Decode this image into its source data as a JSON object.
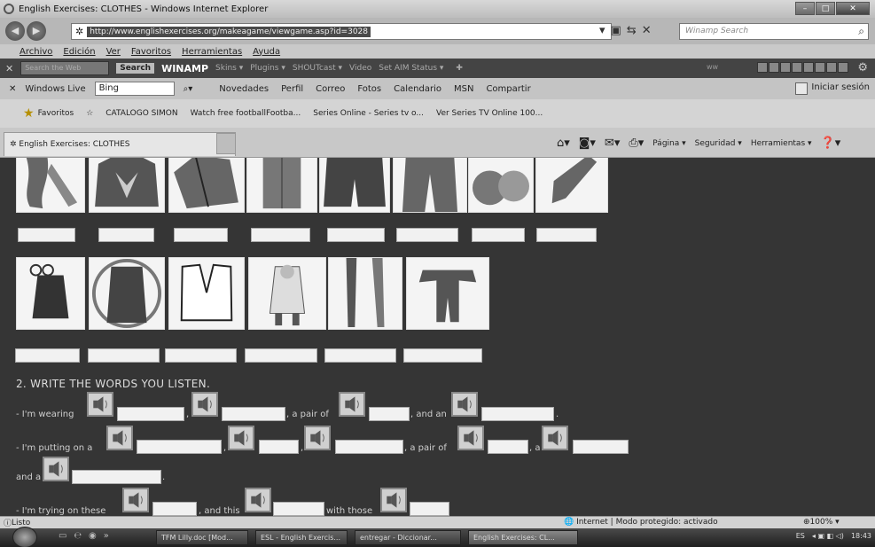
{
  "window": {
    "title": "English Exercises: CLOTHES - Windows Internet Explorer"
  },
  "address": {
    "url": "http://www.englishexercises.org/makeagame/viewgame.asp?id=3028",
    "search_placeholder": "Winamp Search"
  },
  "menu": [
    "Archivo",
    "Edición",
    "Ver",
    "Favoritos",
    "Herramientas",
    "Ayuda"
  ],
  "winamp_bar": {
    "search_placeholder": "Search the Web",
    "search_button": "Search",
    "brand": "WINAMP",
    "items": [
      "Skins ▾",
      "Plugins ▾",
      "SHOUTcast ▾",
      "Video",
      "Set AIM Status ▾"
    ],
    "ww": "ww"
  },
  "live_bar": {
    "label": "Windows Live",
    "search_value": "Bing",
    "links": [
      "Novedades",
      "Perfil",
      "Correo",
      "Fotos",
      "Calendario",
      "MSN",
      "Compartir"
    ],
    "signin": "Iniciar sesión"
  },
  "favorites_bar": {
    "favorites": "Favoritos",
    "items": [
      "CATALOGO SIMON",
      "Watch free footballFootba...",
      "Series Online - Series tv o...",
      "Ver Series TV Online 100..."
    ]
  },
  "tab": {
    "title": "English Exercises: CLOTHES"
  },
  "commands": {
    "page": "Página ▾",
    "security": "Seguridad ▾",
    "tools": "Herramientas ▾"
  },
  "exercise": {
    "heading": "2. WRITE THE WORDS YOU LISTEN.",
    "line1": {
      "start": "- I'm wearing",
      "comma": ",",
      "pair": ", a pair of",
      "and_an": ", and an",
      "end": "."
    },
    "line2": {
      "start": "- I'm putting on a",
      "comma1": ",",
      "comma2": ",",
      "pair": ", a pair of",
      "a": ", a"
    },
    "line3": {
      "start": "and a",
      "end": "."
    },
    "line4": {
      "start": "- I'm trying on these",
      "and_this": ", and this",
      "with_those": "with those"
    }
  },
  "status": {
    "left": "Listo",
    "zone": "Internet | Modo protegido: activado",
    "zoom": "100%"
  },
  "taskbar": {
    "buttons": [
      "TFM Lilly.doc [Mod...",
      "ESL - English Exercis...",
      "entregar - Diccionar...",
      "English Exercises: CL..."
    ],
    "lang": "ES",
    "time": "18:43"
  }
}
